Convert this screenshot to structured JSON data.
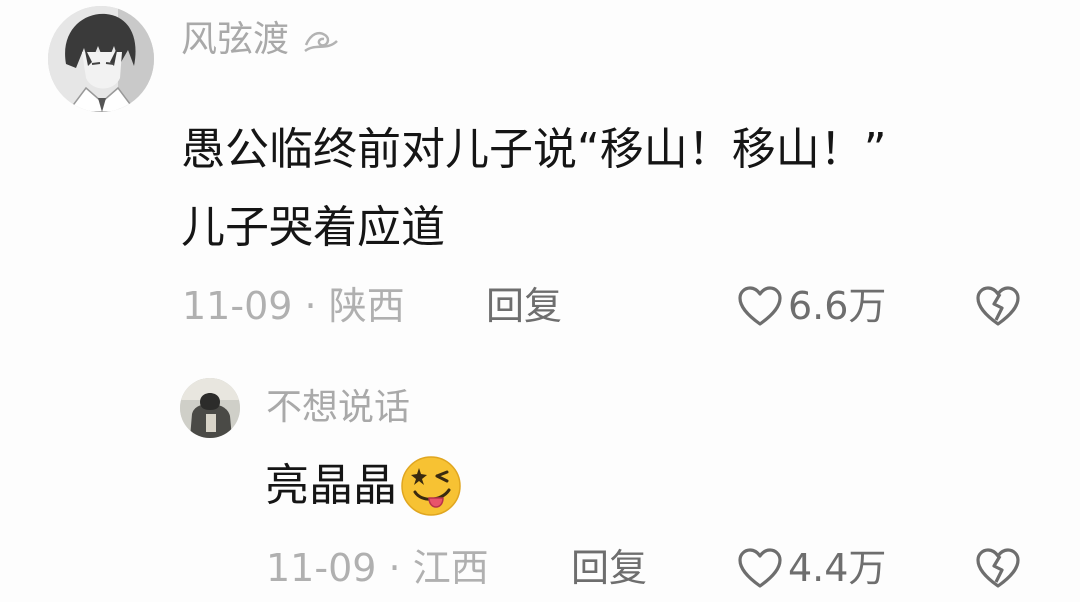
{
  "comments": [
    {
      "username": "风弦渡",
      "username_suffix_icon": "wave-decoration-icon",
      "avatar_icon": "anime-character-avatar",
      "text_lines": [
        "愚公临终前对儿子说“移山！移山！”",
        "儿子哭着应道"
      ],
      "date": "11-09",
      "separator": "·",
      "location": "陕西",
      "reply_label": "回复",
      "like_icon": "heart-outline-icon",
      "like_count": "6.6万",
      "dislike_icon": "broken-heart-icon"
    }
  ],
  "replies": [
    {
      "username": "不想说话",
      "avatar_icon": "user-photo-avatar",
      "text": "亮晶晶",
      "emoji_icon": "tongue-out-wink-emoji",
      "date": "11-09",
      "separator": "·",
      "location": "江西",
      "reply_label": "回复",
      "like_icon": "heart-outline-icon",
      "like_count": "4.4万",
      "dislike_icon": "broken-heart-icon"
    }
  ],
  "colors": {
    "background": "#fdfdfd",
    "username": "#a9a9a9",
    "text": "#151515",
    "meta": "#b0b0b0",
    "action": "#6e6e6e",
    "emoji": "#f7c233"
  }
}
